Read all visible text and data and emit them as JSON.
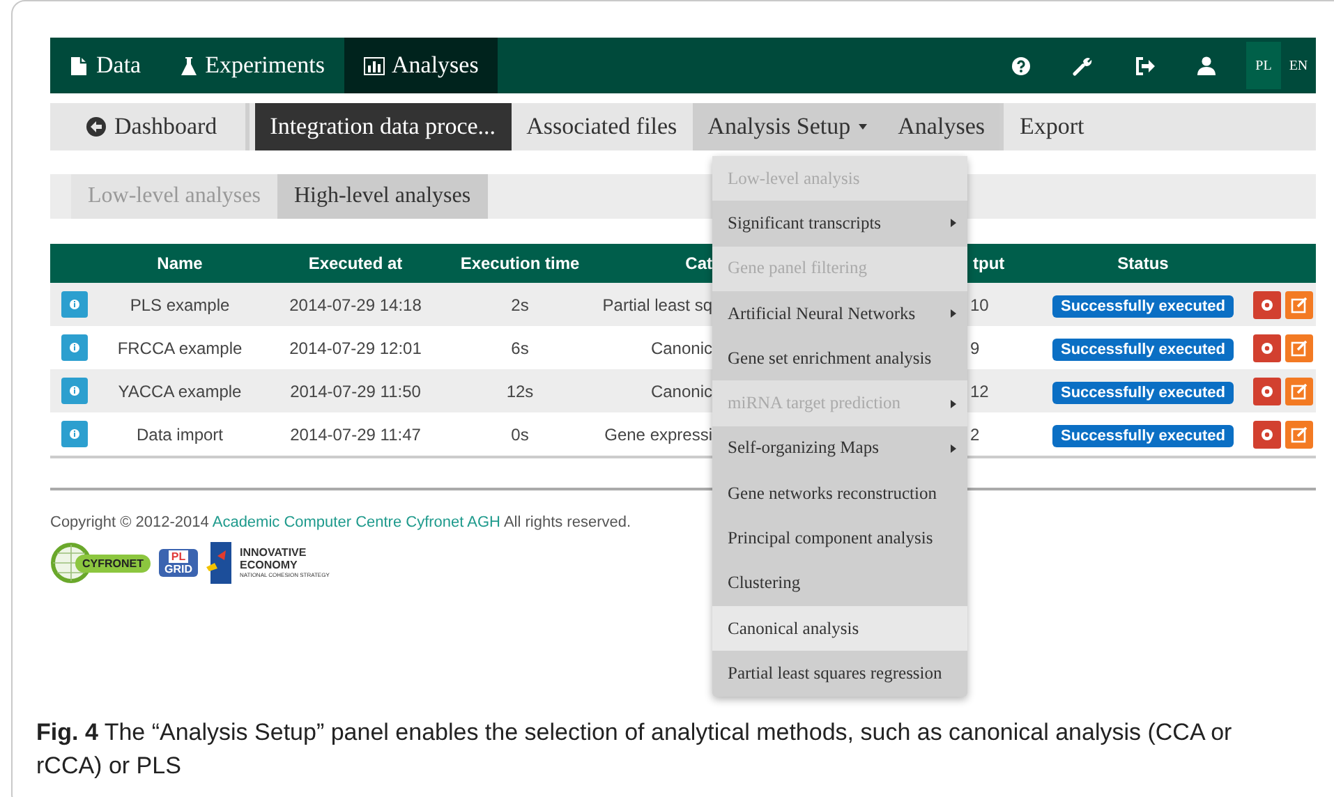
{
  "top_nav": {
    "items": [
      {
        "label": "Data",
        "selected": false
      },
      {
        "label": "Experiments",
        "selected": false
      },
      {
        "label": "Analyses",
        "selected": true
      }
    ],
    "languages": [
      {
        "label": "PL",
        "selected": true
      },
      {
        "label": "EN",
        "selected": false
      }
    ]
  },
  "sub_nav": {
    "items": [
      {
        "label": "Dashboard",
        "kind": "back",
        "selected": false,
        "highlighted": false
      },
      {
        "label": "Integration data proce...",
        "kind": "tab",
        "selected": true,
        "highlighted": false
      },
      {
        "label": "Associated files",
        "kind": "tab",
        "selected": false,
        "highlighted": false
      },
      {
        "label": "Analysis Setup",
        "kind": "dropdown",
        "selected": false,
        "highlighted": true
      },
      {
        "label": "Analyses",
        "kind": "tab",
        "selected": false,
        "highlighted": true
      },
      {
        "label": "Export",
        "kind": "tab",
        "selected": false,
        "highlighted": false
      }
    ]
  },
  "level_tabs": [
    {
      "label": "Low-level analyses",
      "selected": false
    },
    {
      "label": "High-level analyses",
      "selected": true
    }
  ],
  "table": {
    "columns": [
      "Name",
      "Executed at",
      "Execution time",
      "Cat",
      "tput",
      "Status"
    ],
    "rows": [
      {
        "name": "PLS example",
        "executed_at": "2014-07-29 14:18",
        "execution_time": "2s",
        "column_4": "Partial least sq",
        "column_5": "10",
        "status": "Successfully executed"
      },
      {
        "name": "FRCCA example",
        "executed_at": "2014-07-29 12:01",
        "execution_time": "6s",
        "column_4": "Canonic",
        "column_5": "9",
        "status": "Successfully executed"
      },
      {
        "name": "YACCA example",
        "executed_at": "2014-07-29 11:50",
        "execution_time": "12s",
        "column_4": "Canonic",
        "column_5": "12",
        "status": "Successfully executed"
      },
      {
        "name": "Data import",
        "executed_at": "2014-07-29 11:47",
        "execution_time": "0s",
        "column_4": "Gene expressi",
        "column_5": "2",
        "status": "Successfully executed"
      }
    ]
  },
  "dropdown": {
    "items": [
      {
        "label": "Low-level analysis",
        "disabled": true,
        "submenu": false,
        "selected": false
      },
      {
        "label": "Significant transcripts",
        "disabled": false,
        "submenu": true,
        "selected": false
      },
      {
        "label": "Gene panel filtering",
        "disabled": true,
        "submenu": false,
        "selected": false
      },
      {
        "label": "Artificial Neural Networks",
        "disabled": false,
        "submenu": true,
        "selected": false
      },
      {
        "label": "Gene set enrichment analysis",
        "disabled": false,
        "submenu": false,
        "selected": false
      },
      {
        "label": "miRNA target prediction",
        "disabled": true,
        "submenu": true,
        "selected": false
      },
      {
        "label": "Self-organizing Maps",
        "disabled": false,
        "submenu": true,
        "selected": false
      },
      {
        "label": "Gene networks reconstruction",
        "disabled": false,
        "submenu": false,
        "selected": false
      },
      {
        "label": "Principal component analysis",
        "disabled": false,
        "submenu": false,
        "selected": false
      },
      {
        "label": "Clustering",
        "disabled": false,
        "submenu": false,
        "selected": false
      },
      {
        "label": "Canonical analysis",
        "disabled": false,
        "submenu": false,
        "selected": true
      },
      {
        "label": "Partial least squares regression",
        "disabled": false,
        "submenu": false,
        "selected": false
      }
    ]
  },
  "footer": {
    "copyright_before": "Copyright © 2012-2014",
    "link": "Academic Computer Centre Cyfronet AGH",
    "copyright_after": "All rights reserved.",
    "logos": {
      "cyfronet": "CYFRONET",
      "plgrid_top": "PL",
      "plgrid_bottom": "GRID",
      "ie_line_1": "INNOVATIVE",
      "ie_line_2": "ECONOMY",
      "ie_line_3": "NATIONAL COHESION STRATEGY"
    }
  },
  "caption": "**Fig. 4** The “Analysis Setup” panel enables the selection of analytical methods, such as canonical analysis (CCA or rCCA) or PLS"
}
